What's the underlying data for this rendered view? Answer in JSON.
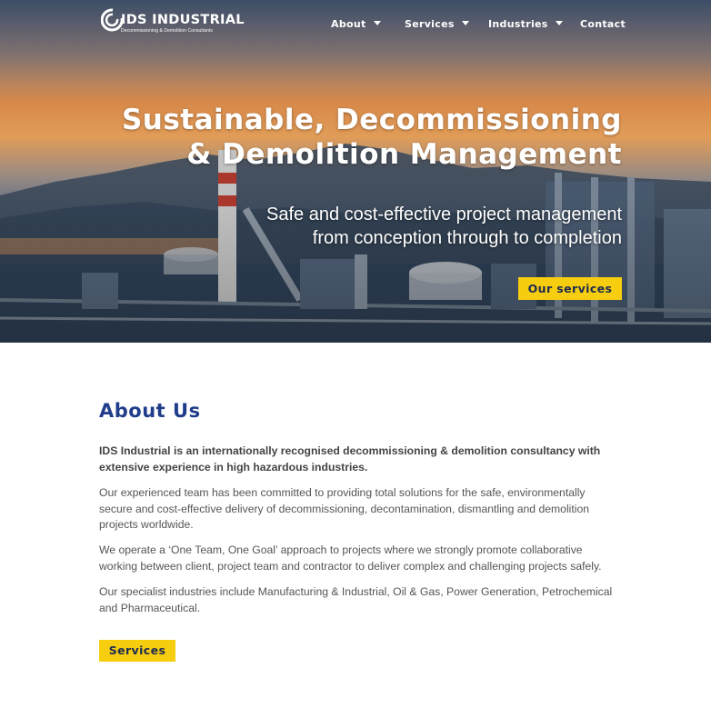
{
  "header": {
    "logo_name": "IDS INDUSTRIAL",
    "logo_tagline": "Decommissioning & Demolition Consultants",
    "nav": [
      {
        "label": "About",
        "has_dropdown": true
      },
      {
        "label": "Services",
        "has_dropdown": true
      },
      {
        "label": "Industries",
        "has_dropdown": true
      },
      {
        "label": "Contact",
        "has_dropdown": false
      }
    ]
  },
  "hero": {
    "title_line1": "Sustainable, Decommissioning",
    "title_line2": "& Demolition Management",
    "subtitle_line1": "Safe and cost-effective project management",
    "subtitle_line2": "from conception through to completion",
    "button_label": "Our services"
  },
  "about": {
    "title": "About Us",
    "paragraphs": [
      "IDS Industrial is an internationally recognised decommissioning & demolition consultancy with extensive experience in high hazardous industries.",
      "Our experienced team has been committed to providing total solutions for the safe, environmentally secure and cost-effective delivery of decommissioning, decontamination, dismantling and demolition projects worldwide.",
      "We operate a ‘One Team, One Goal’ approach to projects where we strongly promote collaborative working between client, project team and contractor to deliver complex and challenging projects safely.",
      "Our specialist industries include Manufacturing & Industrial, Oil & Gas, Power Generation, Petrochemical and Pharmaceutical."
    ],
    "button_label": "Services"
  },
  "colors": {
    "accent_yellow": "#f6cd0f",
    "heading_blue": "#1f3d8a",
    "button_text": "#1d2b52"
  }
}
